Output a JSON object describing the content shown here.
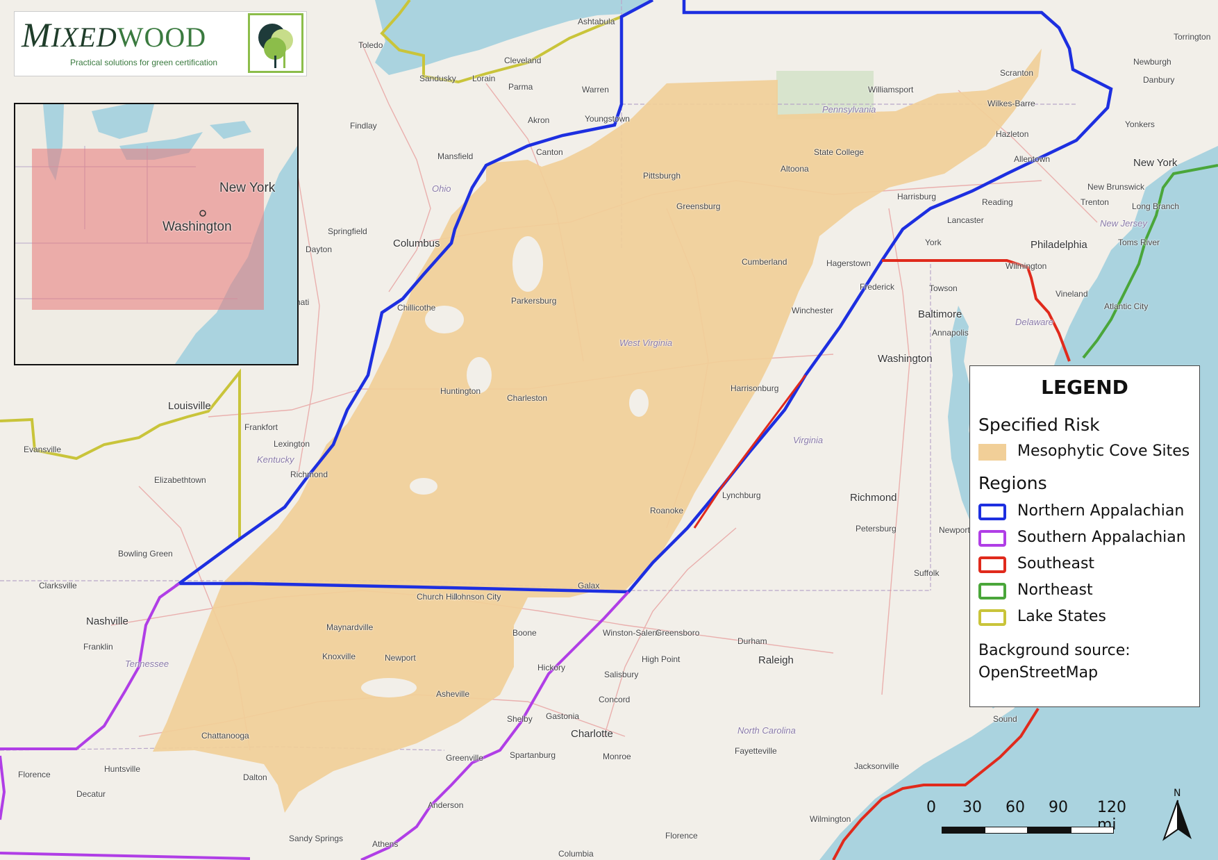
{
  "logo": {
    "brand_first": "M",
    "brand_rest": "IXED",
    "brand_second": "WOOD",
    "tagline": "Practical solutions for green certification"
  },
  "inset": {
    "labels": [
      "New York",
      "Washington"
    ]
  },
  "legend": {
    "title": "LEGEND",
    "risk_heading": "Specified Risk",
    "risk_item": "Mesophytic Cove Sites",
    "regions_heading": "Regions",
    "regions": [
      {
        "label": "Northern Appalachian",
        "color": "#1d2fe0"
      },
      {
        "label": "Southern Appalachian",
        "color": "#b03ee6"
      },
      {
        "label": "Southeast",
        "color": "#e02a1c"
      },
      {
        "label": "Northeast",
        "color": "#4aa63a"
      },
      {
        "label": "Lake States",
        "color": "#c9c43a"
      }
    ],
    "source_line1": "Background source:",
    "source_line2": "OpenStreetMap",
    "cove_color": "#f1cf98"
  },
  "scale": {
    "ticks": [
      "0",
      "30",
      "60",
      "90",
      "120 mi"
    ]
  },
  "north_label": "N",
  "places": {
    "toledo": "Toledo",
    "ashtabula": "Ashtabula",
    "cleveland": "Cleveland",
    "sandusky": "Sandusky",
    "lorain": "Lorain",
    "parma": "Parma",
    "warren": "Warren",
    "akron": "Akron",
    "youngstown": "Youngstown",
    "findlay": "Findlay",
    "mansfield": "Mansfield",
    "canton": "Canton",
    "ohio": "Ohio",
    "columbus": "Columbus",
    "springfield": "Springfield",
    "dayton": "Dayton",
    "chillicothe": "Chillicothe",
    "parkersburg": "Parkersburg",
    "pittsburgh": "Pittsburgh",
    "greensburg": "Greensburg",
    "pennsylvania": "Pennsylvania",
    "state_college": "State College",
    "altoona": "Altoona",
    "williamsport": "Williamsport",
    "scranton": "Scranton",
    "wilkes_barre": "Wilkes-Barre",
    "hazleton": "Hazleton",
    "allentown": "Allentown",
    "harrisburg": "Harrisburg",
    "reading": "Reading",
    "lancaster": "Lancaster",
    "york": "York",
    "new_york": "New York",
    "yonkers": "Yonkers",
    "newburgh": "Newburgh",
    "danbury": "Danbury",
    "torrington": "Torrington",
    "new_brunswick": "New Brunswick",
    "trenton": "Trenton",
    "long_branch": "Long Branch",
    "new_jersey": "New Jersey",
    "toms_river": "Toms River",
    "philadelphia": "Philadelphia",
    "wilmington_de": "Wilmington",
    "vineland": "Vineland",
    "atlantic_city": "Atlantic City",
    "delaware": "Delaware",
    "cumberland": "Cumberland",
    "hagerstown": "Hagerstown",
    "frederick": "Frederick",
    "towson": "Towson",
    "baltimore": "Baltimore",
    "annapolis": "Annapolis",
    "washington": "Washington",
    "winchester": "Winchester",
    "west_virginia": "West Virginia",
    "harrisonburg": "Harrisonburg",
    "virginia": "Virginia",
    "huntington": "Huntington",
    "charleston": "Charleston",
    "louisville": "Louisville",
    "frankfort": "Frankfort",
    "lexington": "Lexington",
    "kentucky": "Kentucky",
    "richmond_ky": "Richmond",
    "elizabethtown": "Elizabethtown",
    "evansville": "Evansville",
    "bowling_green": "Bowling Green",
    "clarksville": "Clarksville",
    "nashville": "Nashville",
    "franklin": "Franklin",
    "tennessee": "Tennessee",
    "maynardville": "Maynardville",
    "knoxville": "Knoxville",
    "newport": "Newport",
    "johnson_city": "Johnson City",
    "church_hill": "Church Hill",
    "galax": "Galax",
    "roanoke": "Roanoke",
    "lynchburg": "Lynchburg",
    "richmond_va": "Richmond",
    "petersburg": "Petersburg",
    "newport_news": "Newport News",
    "suffolk": "Suffolk",
    "boone": "Boone",
    "winston_salem": "Winston-Salem",
    "greensboro": "Greensboro",
    "durham": "Durham",
    "raleigh": "Raleigh",
    "high_point": "High Point",
    "hickory": "Hickory",
    "salisbury": "Salisbury",
    "concord": "Concord",
    "asheville": "Asheville",
    "gastonia": "Gastonia",
    "shelby": "Shelby",
    "charlotte": "Charlotte",
    "monroe": "Monroe",
    "north_carolina": "North Carolina",
    "fayetteville": "Fayetteville",
    "jacksonville": "Jacksonville",
    "wilmington_nc": "Wilmington",
    "greenville": "Greenville",
    "spartanburg": "Spartanburg",
    "anderson": "Anderson",
    "athens": "Athens",
    "sandy_springs": "Sandy Springs",
    "columbia": "Columbia",
    "florence_sc": "Florence",
    "chattanooga": "Chattanooga",
    "dalton": "Dalton",
    "huntsville": "Huntsville",
    "florence_al": "Florence",
    "decatur": "Decatur",
    "cincinnati": "nati",
    "pamlico": "Sound"
  }
}
